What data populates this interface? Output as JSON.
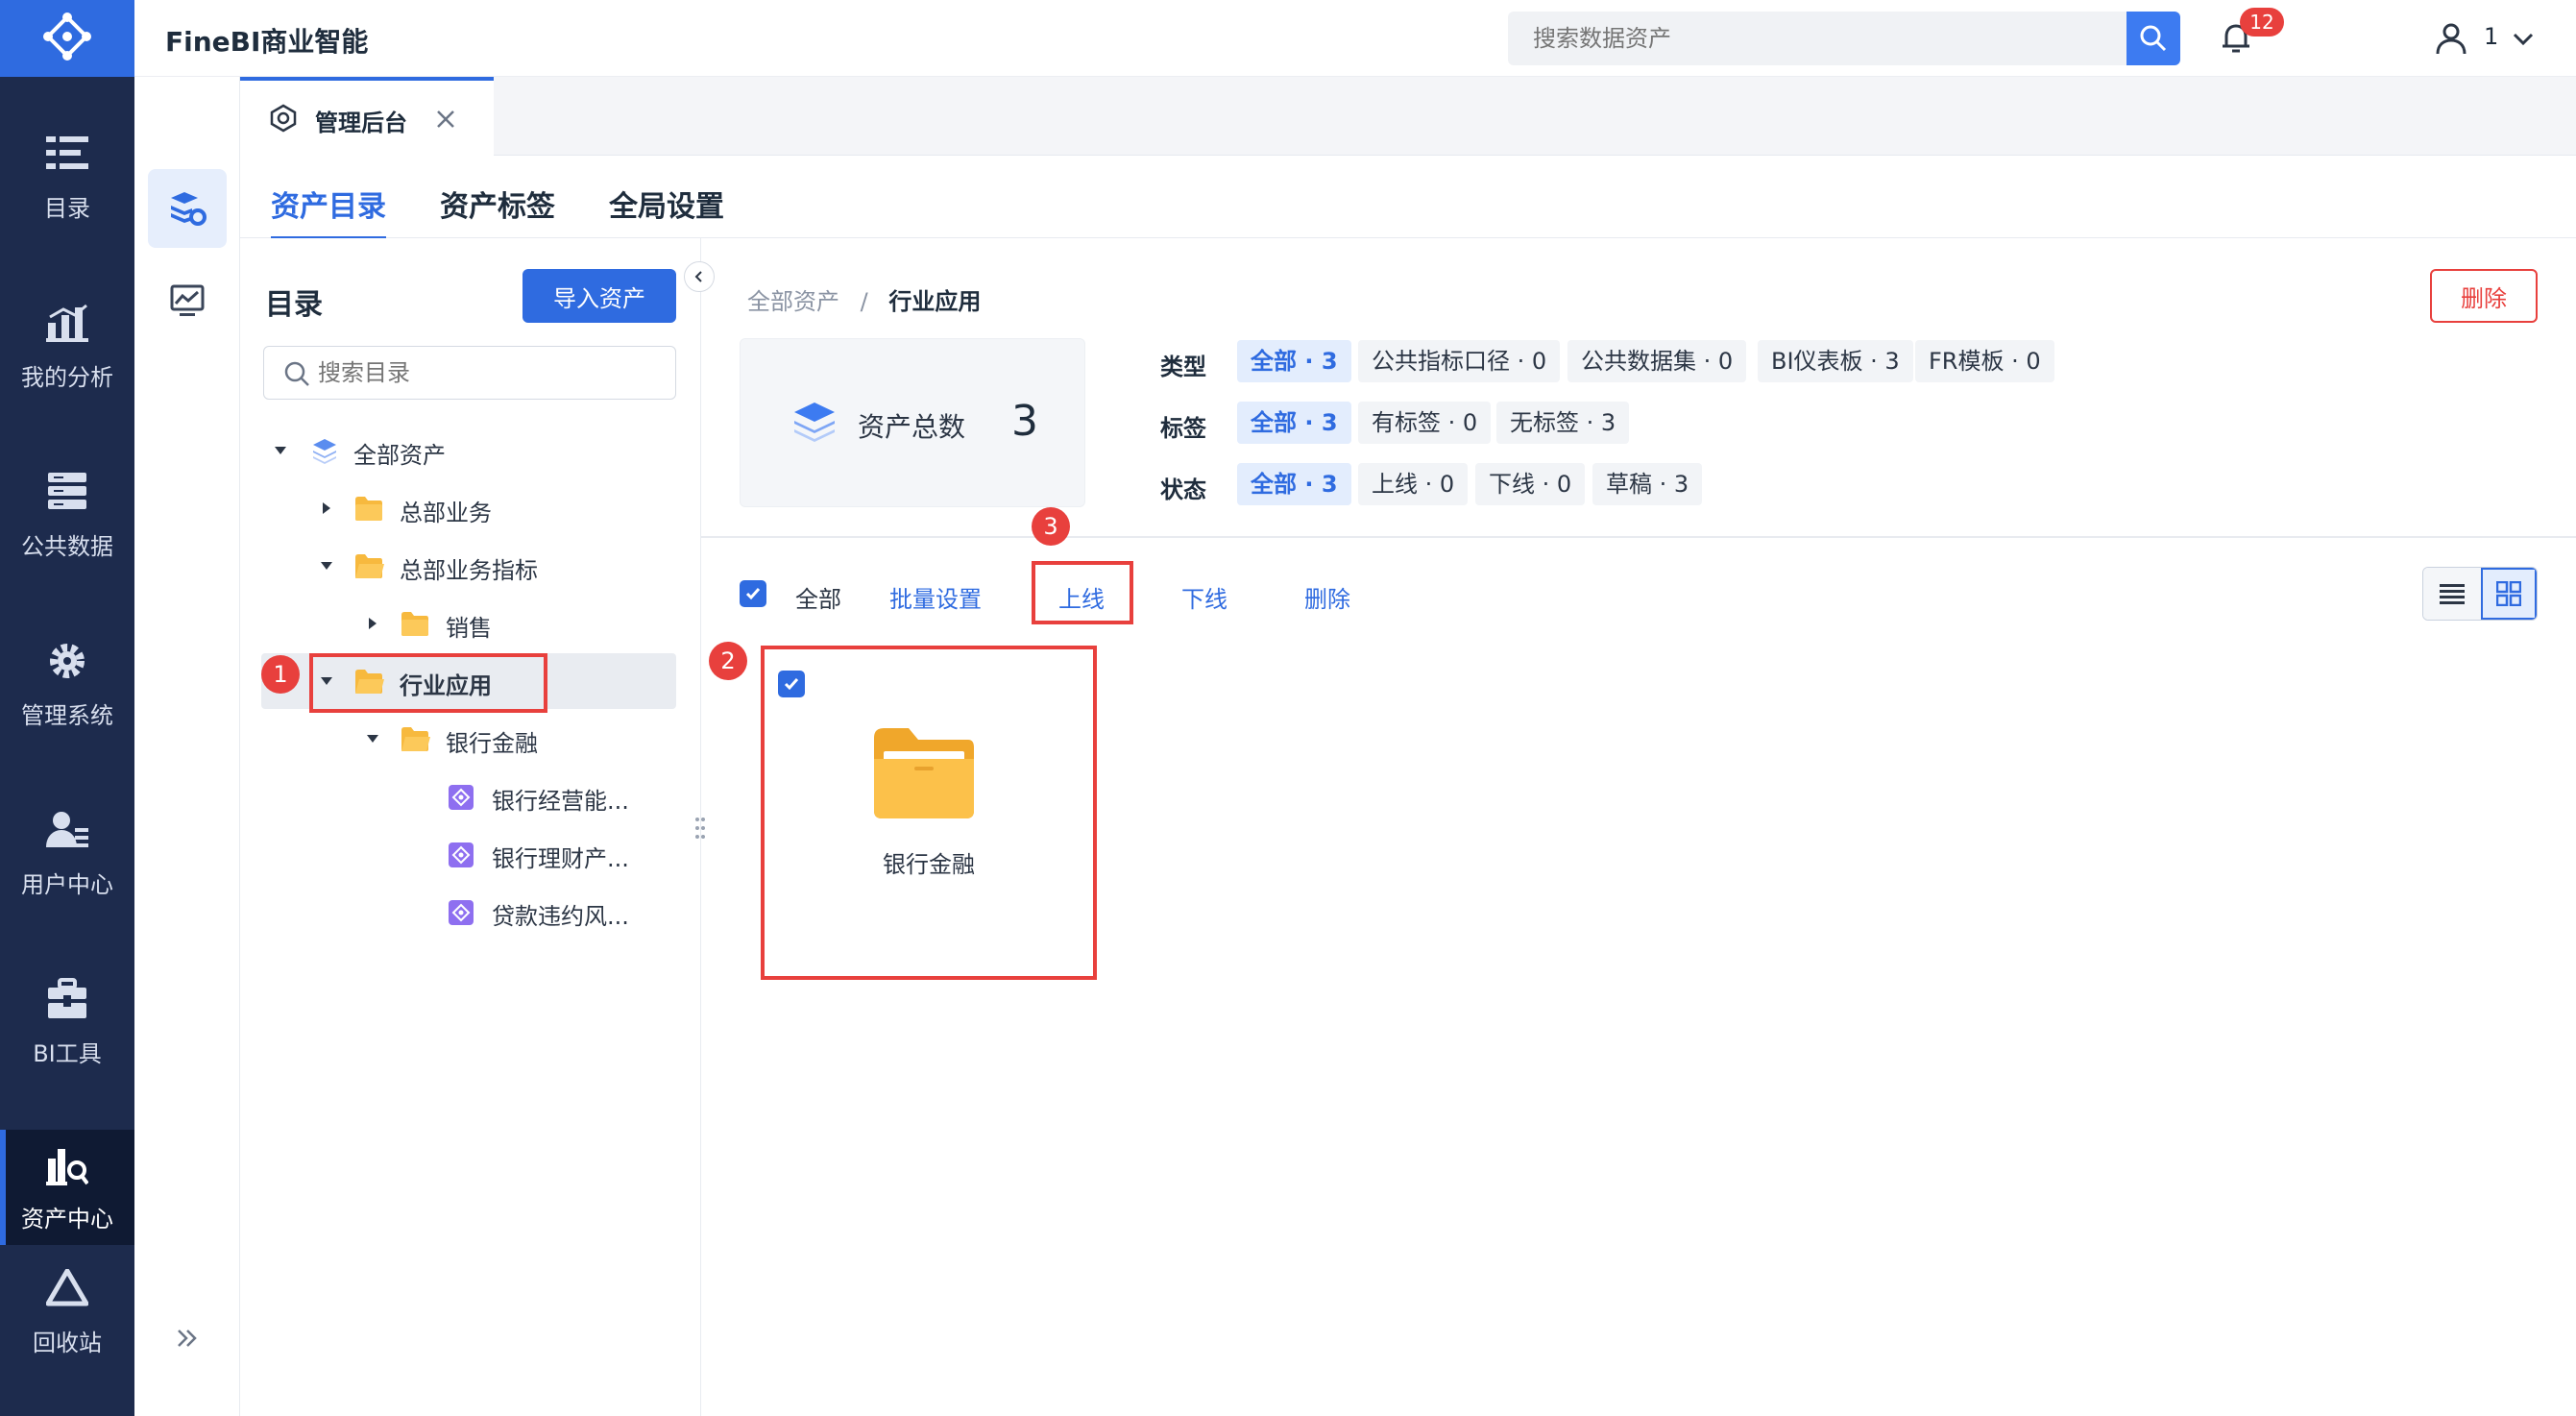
{
  "app": {
    "title": "FineBI商业智能"
  },
  "colors": {
    "primary": "#2f6be0",
    "nav_bg": "#1d2b4d",
    "danger": "#e8403d",
    "folder": "#f7b93e"
  },
  "header": {
    "search_placeholder": "搜索数据资产",
    "notification_count": "12",
    "user_name": "1",
    "icons": [
      "search-icon",
      "bell-icon",
      "user-icon",
      "chevron-down-icon"
    ]
  },
  "leftnav": {
    "items": [
      {
        "label": "目录",
        "icon": "catalog-icon"
      },
      {
        "label": "我的分析",
        "icon": "analysis-icon"
      },
      {
        "label": "公共数据",
        "icon": "public-data-icon"
      },
      {
        "label": "管理系统",
        "icon": "gear-icon"
      },
      {
        "label": "用户中心",
        "icon": "user-center-icon"
      },
      {
        "label": "BI工具",
        "icon": "toolbox-icon"
      },
      {
        "label": "资产中心",
        "icon": "asset-center-icon",
        "active": true
      },
      {
        "label": "回收站",
        "icon": "recycle-icon"
      }
    ],
    "expand_icon": "double-chevron-right-icon"
  },
  "tabbar": {
    "tabs": [
      {
        "label": "管理后台",
        "icon": "settings-hex-icon",
        "closable": true
      }
    ]
  },
  "subtabs": [
    "资产目录",
    "资产标签",
    "全局设置"
  ],
  "tree": {
    "title": "目录",
    "import_button": "导入资产",
    "search_placeholder": "搜索目录",
    "nodes": [
      {
        "label": "全部资产",
        "level": 0,
        "expanded": true,
        "icon": "layers-icon"
      },
      {
        "label": "总部业务",
        "level": 1,
        "expanded": false,
        "icon": "folder-icon"
      },
      {
        "label": "总部业务指标",
        "level": 1,
        "expanded": true,
        "icon": "folder-icon"
      },
      {
        "label": "销售",
        "level": 2,
        "expanded": false,
        "icon": "folder-icon"
      },
      {
        "label": "行业应用",
        "level": 1,
        "expanded": true,
        "icon": "folder-icon",
        "selected": true
      },
      {
        "label": "银行金融",
        "level": 2,
        "expanded": true,
        "icon": "folder-icon"
      },
      {
        "label": "银行经营能...",
        "level": 3,
        "icon": "dashboard-icon"
      },
      {
        "label": "银行理财产...",
        "level": 3,
        "icon": "dashboard-icon"
      },
      {
        "label": "贷款违约风...",
        "level": 3,
        "icon": "dashboard-icon"
      }
    ]
  },
  "main": {
    "breadcrumb": {
      "root": "全部资产",
      "separator": "/",
      "current": "行业应用"
    },
    "delete_button": "删除",
    "total": {
      "label": "资产总数",
      "value": "3"
    },
    "filters": {
      "type": {
        "title": "类型",
        "chips": [
          "全部 · 3",
          "公共指标口径 · 0",
          "公共数据集 · 0",
          "BI仪表板 · 3",
          "FR模板 · 0"
        ]
      },
      "tag": {
        "title": "标签",
        "chips": [
          "全部 · 3",
          "有标签 · 0",
          "无标签 · 3"
        ]
      },
      "status": {
        "title": "状态",
        "chips": [
          "全部 · 3",
          "上线 · 0",
          "下线 · 0",
          "草稿 · 3"
        ]
      }
    },
    "actions": {
      "select_all": "全部",
      "batch": "批量设置",
      "online": "上线",
      "offline": "下线",
      "delete": "删除"
    },
    "cards": [
      {
        "label": "银行金融",
        "checked": true
      }
    ]
  },
  "annotations": {
    "markers": [
      "1",
      "2",
      "3"
    ]
  }
}
